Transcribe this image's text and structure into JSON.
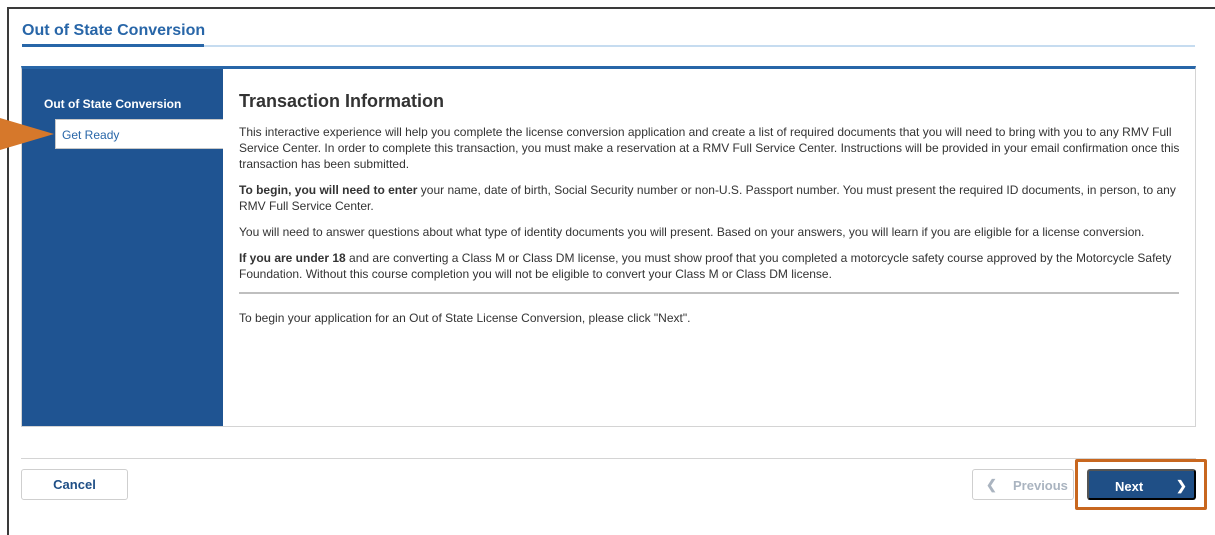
{
  "page": {
    "title": "Out of State Conversion"
  },
  "sidebar": {
    "heading": "Out of State Conversion",
    "items": [
      {
        "label": "Get Ready",
        "active": true
      }
    ]
  },
  "content": {
    "title": "Transaction Information",
    "p1": "This interactive experience will help you complete the license conversion application and create a list of required documents that you will need to bring with you to any RMV Full Service Center. In order to complete this transaction, you must make a reservation at a RMV Full Service Center. Instructions will be provided in your email confirmation once this transaction has been submitted.",
    "p2_bold": "To begin, you will need to enter",
    "p2_rest": " your name, date of birth, Social Security number or non-U.S. Passport number. You must present the required ID documents, in person, to any RMV Full Service Center.",
    "p3": "You will need to answer questions about what type of identity documents you will present. Based on your answers, you will learn if you are eligible for a license conversion.",
    "p4_bold": "If you are under 18",
    "p4_rest": " and are converting a Class M or Class DM license, you must show proof that you completed a motorcycle safety course approved by the Motorcycle Safety Foundation. Without this course completion you will not be eligible to convert your Class M or Class DM license.",
    "p5": "To begin your application for an Out of State License Conversion, please click \"Next\"."
  },
  "footer": {
    "cancel_label": "Cancel",
    "previous_label": "Previous",
    "next_label": "Next"
  },
  "icons": {
    "previous": "chevron-left-icon",
    "next": "chevron-right-icon",
    "callout": "arrow-right-pointer-icon"
  },
  "colors": {
    "brand_blue": "#2866a8",
    "sidebar_blue": "#1f5492",
    "button_blue": "#1f4f86",
    "highlight_orange": "#c8671f"
  }
}
